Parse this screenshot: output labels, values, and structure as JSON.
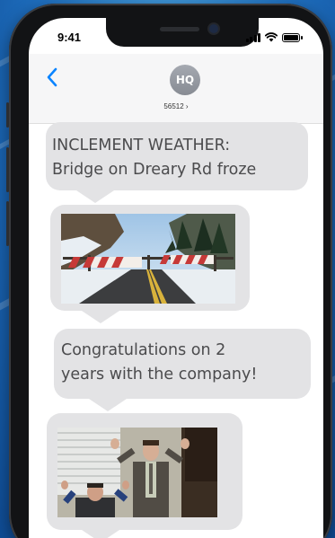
{
  "status": {
    "time": "9:41"
  },
  "contact": {
    "initials": "HQ",
    "number": "56512 ›"
  },
  "messages": {
    "m1": {
      "line1": "INCLEMENT WEATHER:",
      "line2": "Bridge on Dreary Rd froze"
    },
    "m2": {
      "image": "snowy-road-barricade-photo"
    },
    "m3": {
      "line1": "Congratulations on 2",
      "line2": "years with the company!"
    },
    "m4": {
      "image": "office-celebration-photo"
    }
  },
  "icons": {
    "back": "chevron-left-icon",
    "signal": "cellular-signal-icon",
    "wifi": "wifi-icon",
    "battery": "battery-icon"
  },
  "colors": {
    "accent": "#0a84ff",
    "bubble": "#e3e3e5",
    "bubble_text": "#4b4b4d",
    "background": "#1f6fbf"
  }
}
